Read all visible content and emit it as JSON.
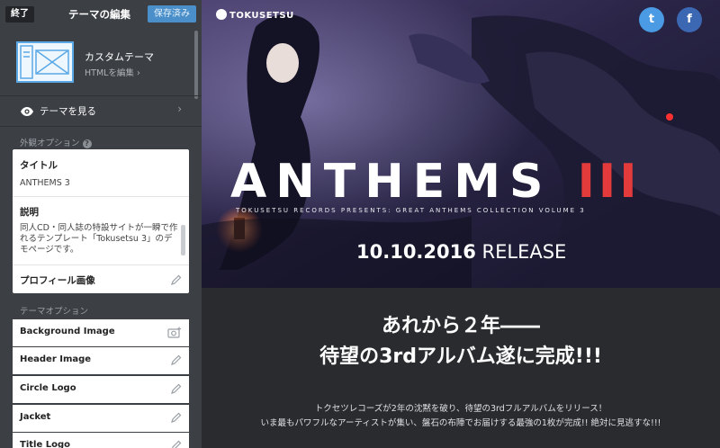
{
  "sidebar": {
    "close_label": "終了",
    "title": "テーマの編集",
    "saved_label": "保存済み",
    "theme": {
      "name": "カスタムテーマ",
      "edit_html": "HTMLを編集 ›"
    },
    "view_theme": "テーマを見る",
    "appearance_section": "外観オプション",
    "fields": {
      "title_label": "タイトル",
      "title_value": "ANTHEMS 3",
      "description_label": "説明",
      "description_value": "同人CD・同人誌の特設サイトが一瞬で作れるテンプレート「Tokusetsu 3」のデモページです。",
      "profile_image_label": "プロフィール画像"
    },
    "theme_options_section": "テーマオプション",
    "theme_options": [
      {
        "label": "Background Image",
        "icon": "camera-add-icon"
      },
      {
        "label": "Header Image",
        "icon": "pencil-icon"
      },
      {
        "label": "Circle Logo",
        "icon": "pencil-icon"
      },
      {
        "label": "Jacket",
        "icon": "pencil-icon"
      },
      {
        "label": "Title Logo",
        "icon": "pencil-icon"
      }
    ]
  },
  "preview": {
    "brand": "TOKUSETSU",
    "twitter": "t",
    "facebook": "f",
    "title_main": "ANTHEMS ",
    "title_num": "III",
    "subtitle": "TOKUSETSU RECORDS PRESENTS: GREAT ANTHEMS COLLECTION VOLUME 3",
    "release_date": "10.10.2016",
    "release_word": " RELEASE",
    "headline1": "あれから２年――",
    "headline2": "待望の3rdアルバム遂に完成!!!",
    "para1": "トクセツレコーズが2年の沈黙を破り、待望の3rdフルアルバムをリリース！",
    "para2": "いま最もパワフルなアーティストが集い、盤石の布陣でお届けする最強の1枚が完成!! 絶対に見逃すな!!!"
  },
  "colors": {
    "accent_blue": "#4a8fc9",
    "twitter": "#4a9be3",
    "facebook": "#3b67b3",
    "title_red": "#e33b3b"
  }
}
